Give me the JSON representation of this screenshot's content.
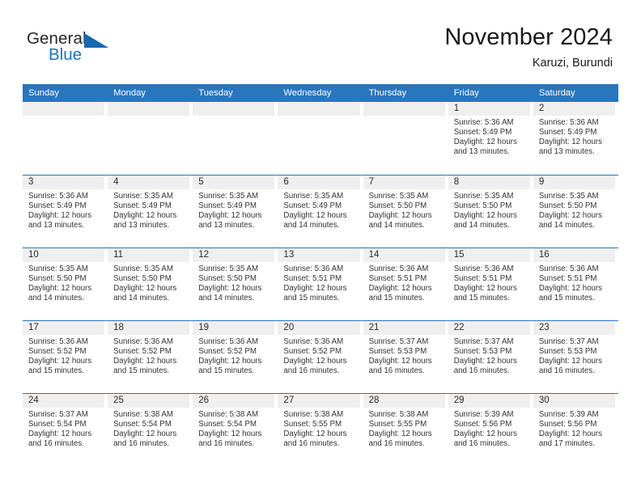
{
  "brand": {
    "name_top": "General",
    "name_bottom": "Blue",
    "accent_color": "#1b72bd",
    "triangle_color": "#1668b3"
  },
  "header": {
    "title": "November 2024",
    "subtitle": "Karuzi, Burundi"
  },
  "calendar": {
    "header_bg": "#2a76bd",
    "daynum_band_bg": "#efefef",
    "weekdays": [
      "Sunday",
      "Monday",
      "Tuesday",
      "Wednesday",
      "Thursday",
      "Friday",
      "Saturday"
    ],
    "weeks": [
      [
        {
          "day": "",
          "empty": true
        },
        {
          "day": "",
          "empty": true
        },
        {
          "day": "",
          "empty": true
        },
        {
          "day": "",
          "empty": true
        },
        {
          "day": "",
          "empty": true
        },
        {
          "day": "1",
          "sunrise": "Sunrise: 5:36 AM",
          "sunset": "Sunset: 5:49 PM",
          "daylight1": "Daylight: 12 hours",
          "daylight2": "and 13 minutes."
        },
        {
          "day": "2",
          "sunrise": "Sunrise: 5:36 AM",
          "sunset": "Sunset: 5:49 PM",
          "daylight1": "Daylight: 12 hours",
          "daylight2": "and 13 minutes."
        }
      ],
      [
        {
          "day": "3",
          "sunrise": "Sunrise: 5:36 AM",
          "sunset": "Sunset: 5:49 PM",
          "daylight1": "Daylight: 12 hours",
          "daylight2": "and 13 minutes."
        },
        {
          "day": "4",
          "sunrise": "Sunrise: 5:35 AM",
          "sunset": "Sunset: 5:49 PM",
          "daylight1": "Daylight: 12 hours",
          "daylight2": "and 13 minutes."
        },
        {
          "day": "5",
          "sunrise": "Sunrise: 5:35 AM",
          "sunset": "Sunset: 5:49 PM",
          "daylight1": "Daylight: 12 hours",
          "daylight2": "and 13 minutes."
        },
        {
          "day": "6",
          "sunrise": "Sunrise: 5:35 AM",
          "sunset": "Sunset: 5:49 PM",
          "daylight1": "Daylight: 12 hours",
          "daylight2": "and 14 minutes."
        },
        {
          "day": "7",
          "sunrise": "Sunrise: 5:35 AM",
          "sunset": "Sunset: 5:50 PM",
          "daylight1": "Daylight: 12 hours",
          "daylight2": "and 14 minutes."
        },
        {
          "day": "8",
          "sunrise": "Sunrise: 5:35 AM",
          "sunset": "Sunset: 5:50 PM",
          "daylight1": "Daylight: 12 hours",
          "daylight2": "and 14 minutes."
        },
        {
          "day": "9",
          "sunrise": "Sunrise: 5:35 AM",
          "sunset": "Sunset: 5:50 PM",
          "daylight1": "Daylight: 12 hours",
          "daylight2": "and 14 minutes."
        }
      ],
      [
        {
          "day": "10",
          "sunrise": "Sunrise: 5:35 AM",
          "sunset": "Sunset: 5:50 PM",
          "daylight1": "Daylight: 12 hours",
          "daylight2": "and 14 minutes."
        },
        {
          "day": "11",
          "sunrise": "Sunrise: 5:35 AM",
          "sunset": "Sunset: 5:50 PM",
          "daylight1": "Daylight: 12 hours",
          "daylight2": "and 14 minutes."
        },
        {
          "day": "12",
          "sunrise": "Sunrise: 5:35 AM",
          "sunset": "Sunset: 5:50 PM",
          "daylight1": "Daylight: 12 hours",
          "daylight2": "and 14 minutes."
        },
        {
          "day": "13",
          "sunrise": "Sunrise: 5:36 AM",
          "sunset": "Sunset: 5:51 PM",
          "daylight1": "Daylight: 12 hours",
          "daylight2": "and 15 minutes."
        },
        {
          "day": "14",
          "sunrise": "Sunrise: 5:36 AM",
          "sunset": "Sunset: 5:51 PM",
          "daylight1": "Daylight: 12 hours",
          "daylight2": "and 15 minutes."
        },
        {
          "day": "15",
          "sunrise": "Sunrise: 5:36 AM",
          "sunset": "Sunset: 5:51 PM",
          "daylight1": "Daylight: 12 hours",
          "daylight2": "and 15 minutes."
        },
        {
          "day": "16",
          "sunrise": "Sunrise: 5:36 AM",
          "sunset": "Sunset: 5:51 PM",
          "daylight1": "Daylight: 12 hours",
          "daylight2": "and 15 minutes."
        }
      ],
      [
        {
          "day": "17",
          "sunrise": "Sunrise: 5:36 AM",
          "sunset": "Sunset: 5:52 PM",
          "daylight1": "Daylight: 12 hours",
          "daylight2": "and 15 minutes."
        },
        {
          "day": "18",
          "sunrise": "Sunrise: 5:36 AM",
          "sunset": "Sunset: 5:52 PM",
          "daylight1": "Daylight: 12 hours",
          "daylight2": "and 15 minutes."
        },
        {
          "day": "19",
          "sunrise": "Sunrise: 5:36 AM",
          "sunset": "Sunset: 5:52 PM",
          "daylight1": "Daylight: 12 hours",
          "daylight2": "and 15 minutes."
        },
        {
          "day": "20",
          "sunrise": "Sunrise: 5:36 AM",
          "sunset": "Sunset: 5:52 PM",
          "daylight1": "Daylight: 12 hours",
          "daylight2": "and 16 minutes."
        },
        {
          "day": "21",
          "sunrise": "Sunrise: 5:37 AM",
          "sunset": "Sunset: 5:53 PM",
          "daylight1": "Daylight: 12 hours",
          "daylight2": "and 16 minutes."
        },
        {
          "day": "22",
          "sunrise": "Sunrise: 5:37 AM",
          "sunset": "Sunset: 5:53 PM",
          "daylight1": "Daylight: 12 hours",
          "daylight2": "and 16 minutes."
        },
        {
          "day": "23",
          "sunrise": "Sunrise: 5:37 AM",
          "sunset": "Sunset: 5:53 PM",
          "daylight1": "Daylight: 12 hours",
          "daylight2": "and 16 minutes."
        }
      ],
      [
        {
          "day": "24",
          "sunrise": "Sunrise: 5:37 AM",
          "sunset": "Sunset: 5:54 PM",
          "daylight1": "Daylight: 12 hours",
          "daylight2": "and 16 minutes."
        },
        {
          "day": "25",
          "sunrise": "Sunrise: 5:38 AM",
          "sunset": "Sunset: 5:54 PM",
          "daylight1": "Daylight: 12 hours",
          "daylight2": "and 16 minutes."
        },
        {
          "day": "26",
          "sunrise": "Sunrise: 5:38 AM",
          "sunset": "Sunset: 5:54 PM",
          "daylight1": "Daylight: 12 hours",
          "daylight2": "and 16 minutes."
        },
        {
          "day": "27",
          "sunrise": "Sunrise: 5:38 AM",
          "sunset": "Sunset: 5:55 PM",
          "daylight1": "Daylight: 12 hours",
          "daylight2": "and 16 minutes."
        },
        {
          "day": "28",
          "sunrise": "Sunrise: 5:38 AM",
          "sunset": "Sunset: 5:55 PM",
          "daylight1": "Daylight: 12 hours",
          "daylight2": "and 16 minutes."
        },
        {
          "day": "29",
          "sunrise": "Sunrise: 5:39 AM",
          "sunset": "Sunset: 5:56 PM",
          "daylight1": "Daylight: 12 hours",
          "daylight2": "and 16 minutes."
        },
        {
          "day": "30",
          "sunrise": "Sunrise: 5:39 AM",
          "sunset": "Sunset: 5:56 PM",
          "daylight1": "Daylight: 12 hours",
          "daylight2": "and 17 minutes."
        }
      ]
    ]
  }
}
